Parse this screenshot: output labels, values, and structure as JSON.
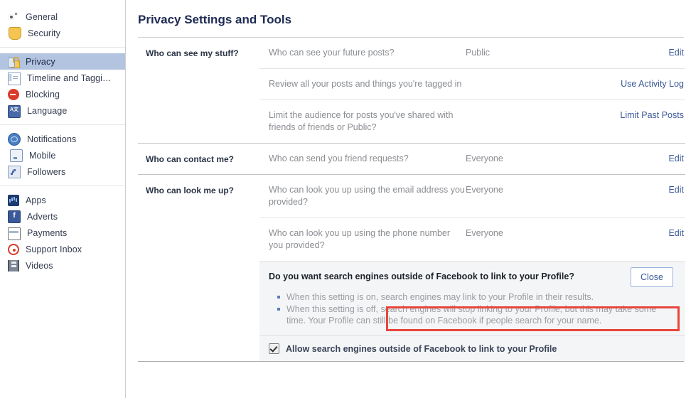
{
  "sidebar": {
    "groups": [
      {
        "items": [
          {
            "label": "General",
            "icon": "gear-icon",
            "selected": false
          },
          {
            "label": "Security",
            "icon": "shield-icon",
            "selected": false
          }
        ]
      },
      {
        "items": [
          {
            "label": "Privacy",
            "icon": "lock-icon",
            "selected": true
          },
          {
            "label": "Timeline and Taggi…",
            "icon": "timeline-icon",
            "selected": false
          },
          {
            "label": "Blocking",
            "icon": "block-icon",
            "selected": false
          },
          {
            "label": "Language",
            "icon": "language-icon",
            "selected": false
          }
        ]
      },
      {
        "items": [
          {
            "label": "Notifications",
            "icon": "globe-icon",
            "selected": false
          },
          {
            "label": "Mobile",
            "icon": "mobile-icon",
            "selected": false
          },
          {
            "label": "Followers",
            "icon": "rss-icon",
            "selected": false
          }
        ]
      },
      {
        "items": [
          {
            "label": "Apps",
            "icon": "apps-icon",
            "selected": false
          },
          {
            "label": "Adverts",
            "icon": "facebook-icon",
            "selected": false
          },
          {
            "label": "Payments",
            "icon": "card-icon",
            "selected": false
          },
          {
            "label": "Support Inbox",
            "icon": "lifebuoy-icon",
            "selected": false
          },
          {
            "label": "Videos",
            "icon": "film-icon",
            "selected": false
          }
        ]
      }
    ]
  },
  "main": {
    "page_title": "Privacy Settings and Tools",
    "sections": [
      {
        "label": "Who can see my stuff?",
        "rows": [
          {
            "desc": "Who can see your future posts?",
            "value": "Public",
            "action": "Edit"
          },
          {
            "desc": "Review all your posts and things you're tagged in",
            "value": "",
            "action": "Use Activity Log"
          },
          {
            "desc": "Limit the audience for posts you've shared with friends of friends or Public?",
            "value": "",
            "action": "Limit Past Posts"
          }
        ]
      },
      {
        "label": "Who can contact me?",
        "rows": [
          {
            "desc": "Who can send you friend requests?",
            "value": "Everyone",
            "action": "Edit"
          }
        ]
      },
      {
        "label": "Who can look me up?",
        "rows": [
          {
            "desc": "Who can look you up using the email address you provided?",
            "value": "Everyone",
            "action": "Edit"
          },
          {
            "desc": "Who can look you up using the phone number you provided?",
            "value": "Everyone",
            "action": "Edit"
          }
        ]
      }
    ],
    "panel": {
      "question": "Do you want search engines outside of Facebook to link to your Profile?",
      "close_label": "Close",
      "bullets": [
        "When this setting is on, search engines may link to your Profile in their results.",
        "When this setting is off, search engines will stop linking to your Profile, but this may take some time. Your Profile can still be found on Facebook if people search for your name."
      ],
      "checkbox_label": "Allow search engines outside of Facebook to link to your Profile",
      "checkbox_checked": true
    }
  },
  "colors": {
    "link": "#3b5998",
    "selected_sidebar": "#b2c4e0",
    "muted_text": "#8a8d91",
    "panel_bg": "#f4f5f7",
    "highlight": "#e8453c"
  }
}
